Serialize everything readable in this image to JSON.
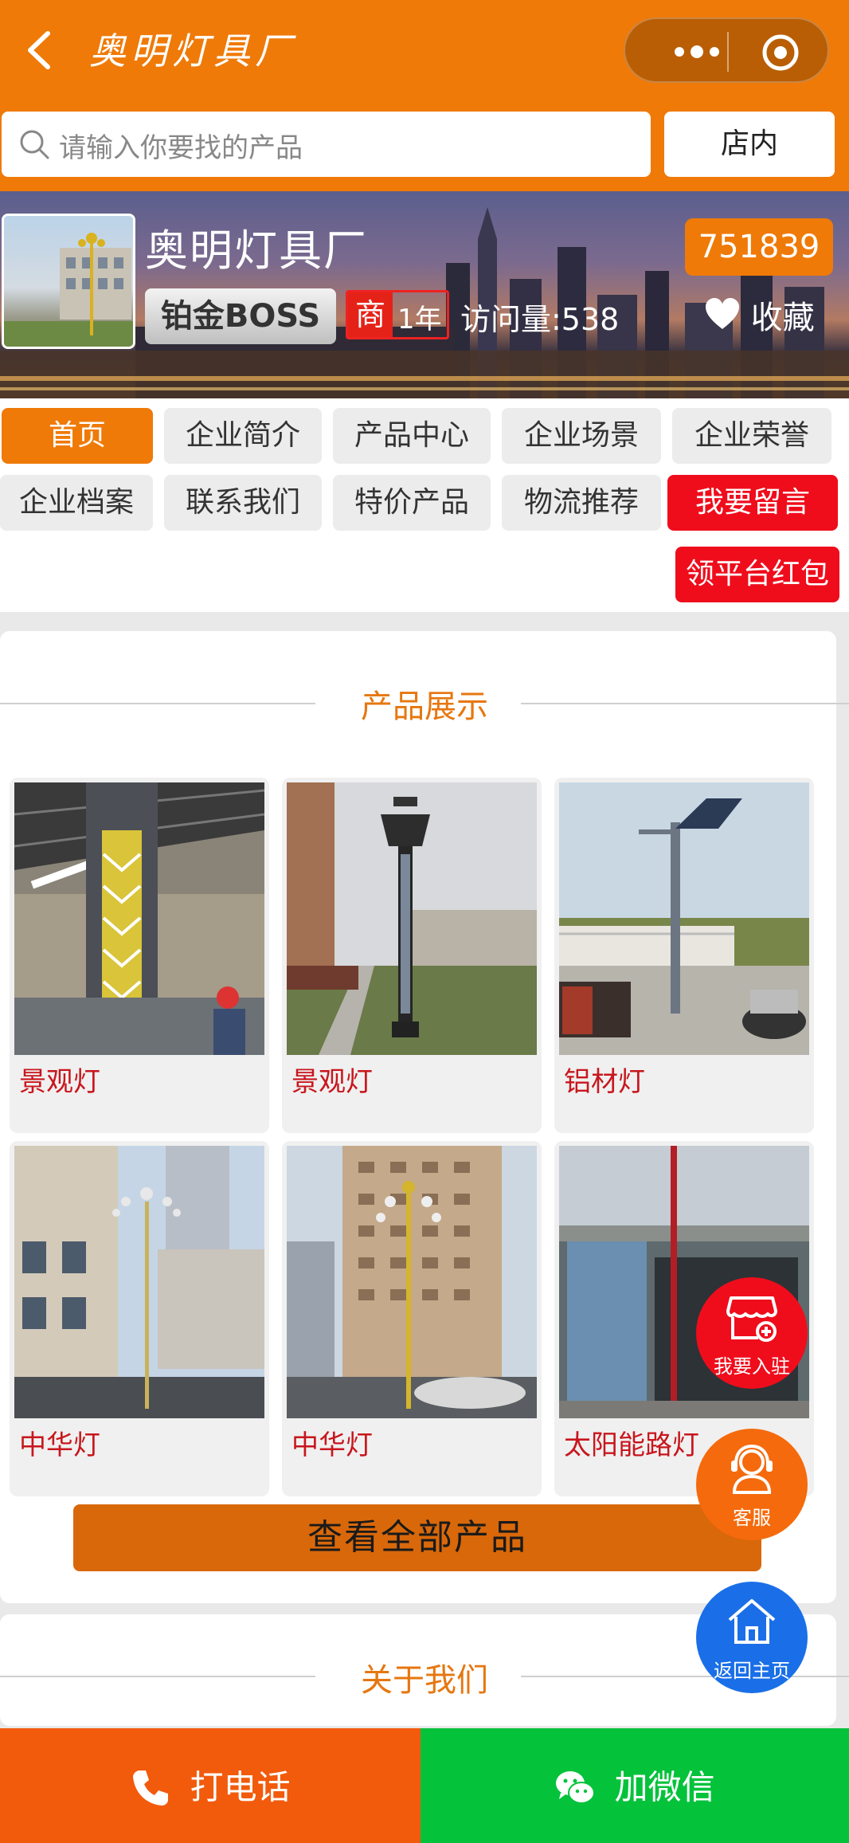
{
  "header": {
    "title": "奥明灯具厂",
    "search_placeholder": "请输入你要找的产品",
    "in_store_label": "店内"
  },
  "shop": {
    "name": "奥明灯具厂",
    "code": "751839",
    "level_badge": "铂金BOSS",
    "merchant_badge": "商",
    "years": "1年",
    "visits": "访问量:538",
    "favorite_label": "收藏"
  },
  "menu": {
    "items": [
      "首页",
      "企业简介",
      "产品中心",
      "企业场景",
      "企业荣誉",
      "企业档案",
      "联系我们",
      "特价产品",
      "物流推荐",
      "我要留言",
      "领平台红包"
    ],
    "active_index": 0
  },
  "products_section": {
    "title": "产品展示",
    "items": [
      {
        "name": "景观灯"
      },
      {
        "name": "景观灯"
      },
      {
        "name": "铝材灯"
      },
      {
        "name": "中华灯"
      },
      {
        "name": "中华灯"
      },
      {
        "name": "太阳能路灯"
      }
    ],
    "view_all_label": "查看全部产品"
  },
  "about_section": {
    "title": "关于我们"
  },
  "floating": {
    "join_label": "我要入驻",
    "service_label": "客服",
    "home_label": "返回主页"
  },
  "bottom_bar": {
    "call_label": "打电话",
    "wechat_label": "加微信"
  },
  "colors": {
    "brand_orange": "#ef7a08",
    "red": "#ef0d1c",
    "call_orange": "#f25a0c",
    "wechat_green": "#05c23b",
    "home_blue": "#1a6fe8"
  }
}
